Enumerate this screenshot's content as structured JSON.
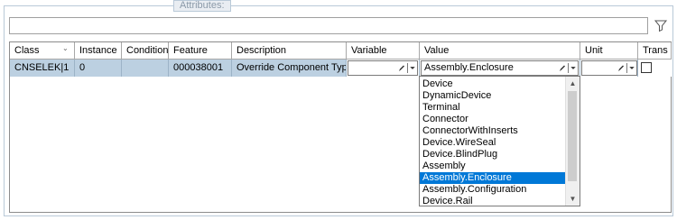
{
  "group": {
    "title": "Attributes:"
  },
  "filter": {
    "value": "",
    "icon": "filter-icon"
  },
  "columns": [
    "Class",
    "Instance",
    "Condition",
    "Feature",
    "Description",
    "Variable",
    "Value",
    "Unit",
    "Trans"
  ],
  "row": {
    "class": "CNSELEK|1",
    "instance": "0",
    "condition": "",
    "feature": "000038001",
    "description": "Override Component Type",
    "variable": "",
    "value": "Assembly.Enclosure",
    "unit": "",
    "trans_checked": false
  },
  "dropdown": {
    "options": [
      "Device",
      "DynamicDevice",
      "Terminal",
      "Connector",
      "ConnectorWithInserts",
      "Device.WireSeal",
      "Device.BlindPlug",
      "Assembly",
      "Assembly.Enclosure",
      "Assembly.Configuration",
      "Device.Rail"
    ],
    "selected": "Assembly.Enclosure"
  },
  "colors": {
    "selection": "#0078d7",
    "row_highlight": "#bcd0e1"
  }
}
